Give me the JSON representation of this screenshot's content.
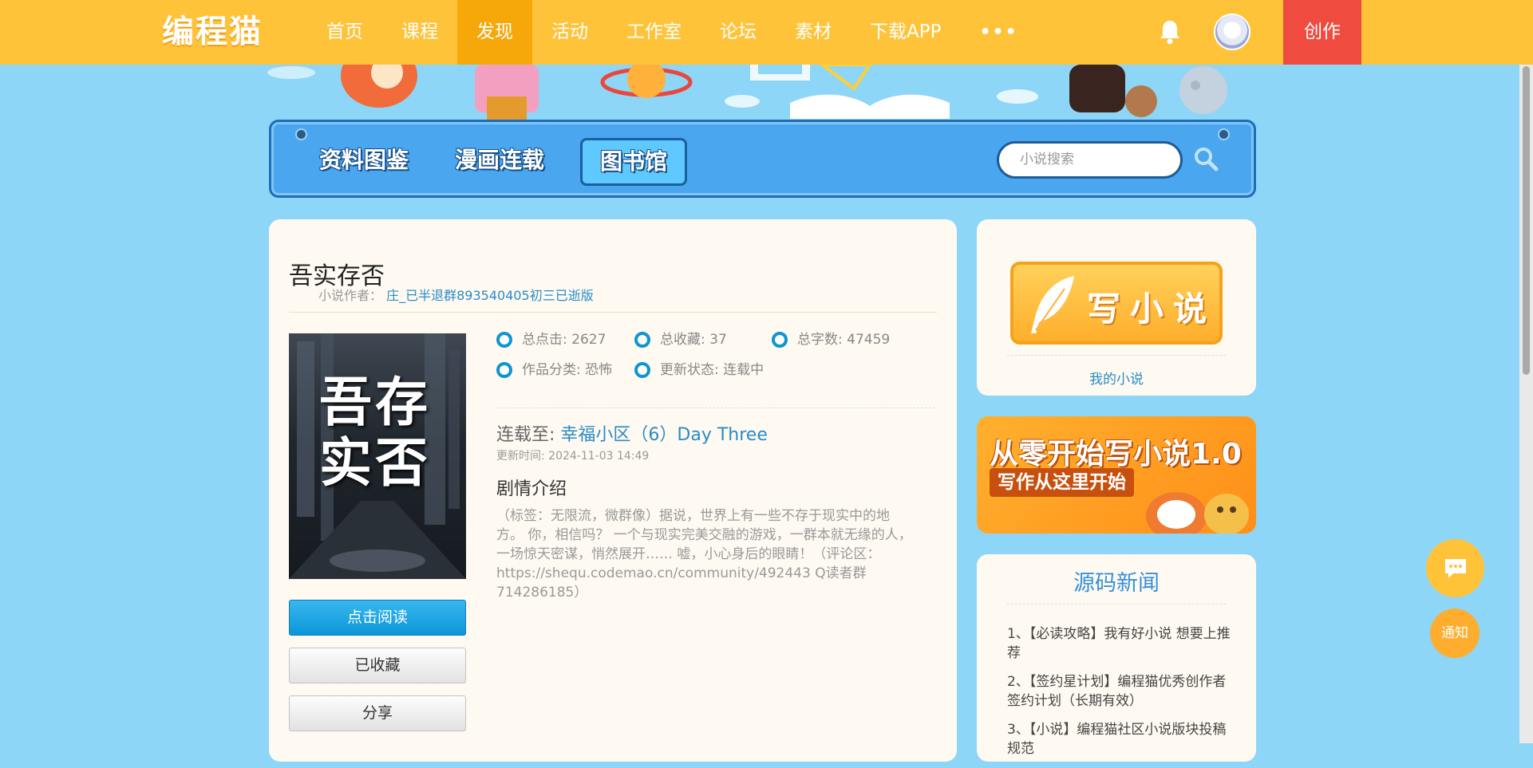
{
  "nav": {
    "logo": "编程猫",
    "items": [
      {
        "label": "首页",
        "active": false
      },
      {
        "label": "课程",
        "active": false
      },
      {
        "label": "发现",
        "active": true
      },
      {
        "label": "活动",
        "active": false
      },
      {
        "label": "工作室",
        "active": false
      },
      {
        "label": "论坛",
        "active": false
      },
      {
        "label": "素材",
        "active": false
      },
      {
        "label": "下载APP",
        "active": false
      }
    ],
    "more": "•••",
    "create_label": "创作",
    "icons": {
      "notifications": "bell-icon",
      "user": "avatar"
    },
    "colors": {
      "bar": "#ffc33a",
      "active": "#f6a80b",
      "create": "#ef4b3e"
    }
  },
  "subnav": {
    "tabs": [
      {
        "label": "资料图鉴",
        "active": false
      },
      {
        "label": "漫画连载",
        "active": false
      },
      {
        "label": "图书馆",
        "active": true
      }
    ],
    "search_placeholder": "小说搜索"
  },
  "book": {
    "title": "吾实存否",
    "author_label": "小说作者：",
    "author": "庄_已半退群893540405初三已逝版",
    "cover_text": "吾存实否",
    "stats": [
      {
        "label": "总点击: 2627"
      },
      {
        "label": "总收藏: 37"
      },
      {
        "label": "总字数: 47459"
      },
      {
        "label": "作品分类: 恐怖"
      },
      {
        "label": "更新状态: 连载中"
      }
    ],
    "latest_label": "连载至:",
    "latest_chapter": "幸福小区（6）Day Three",
    "update_time": "更新时间: 2024-11-03 14:49",
    "synopsis_title": "剧情介绍",
    "synopsis": "（标签：无限流，微群像）据说，世界上有一些不存于现实中的地方。 你，相信吗？ 一个与现实完美交融的游戏，一群本就无缘的人，一场惊天密谋，悄然展开…… 嘘，小心身后的眼睛！（评论区：https://shequ.codemao.cn/community/492443 Q读者群714286185）",
    "actions": {
      "read": "点击阅读",
      "favorited": "已收藏",
      "share": "分享"
    }
  },
  "sidebar": {
    "write_label": "写小说",
    "my_novel": "我的小说",
    "promo_title": "从零开始写小说1.0",
    "promo_sub": "写作从这里开始",
    "news_title": "源码新闻",
    "news": [
      "1、【必读攻略】我有好小说 想要上推荐",
      "2、【签约星计划】编程猫优秀创作者签约计划（长期有效）",
      "3、【小说】编程猫社区小说版块投稿规范"
    ]
  },
  "floating": {
    "chat_icon": "chat-bubble-icon",
    "notice": "通知"
  }
}
